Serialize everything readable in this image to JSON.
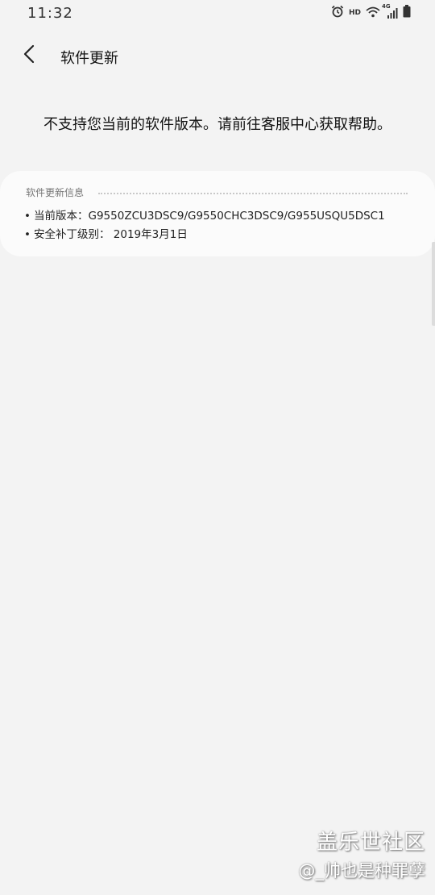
{
  "status_bar": {
    "time": "11:32",
    "hd_label": "HD",
    "network_label": "4G",
    "icons": [
      "alarm-icon",
      "wifi-icon",
      "signal-icon",
      "battery-icon"
    ]
  },
  "header": {
    "back_icon": "chevron-left-icon",
    "title": "软件更新"
  },
  "notice": "不支持您当前的软件版本。请前往客服中心获取帮助。",
  "info_card": {
    "title": "软件更新信息",
    "bullet": "•",
    "current_version": "当前版本：G9550ZCU3DSC9/G9550CHC3DSC9/G955USQU5DSC1",
    "security_patch": "安全补丁级别： 2019年3月1日"
  },
  "watermark": {
    "line1": "盖乐世社区",
    "line2": "@_帅也是种罪孽"
  }
}
